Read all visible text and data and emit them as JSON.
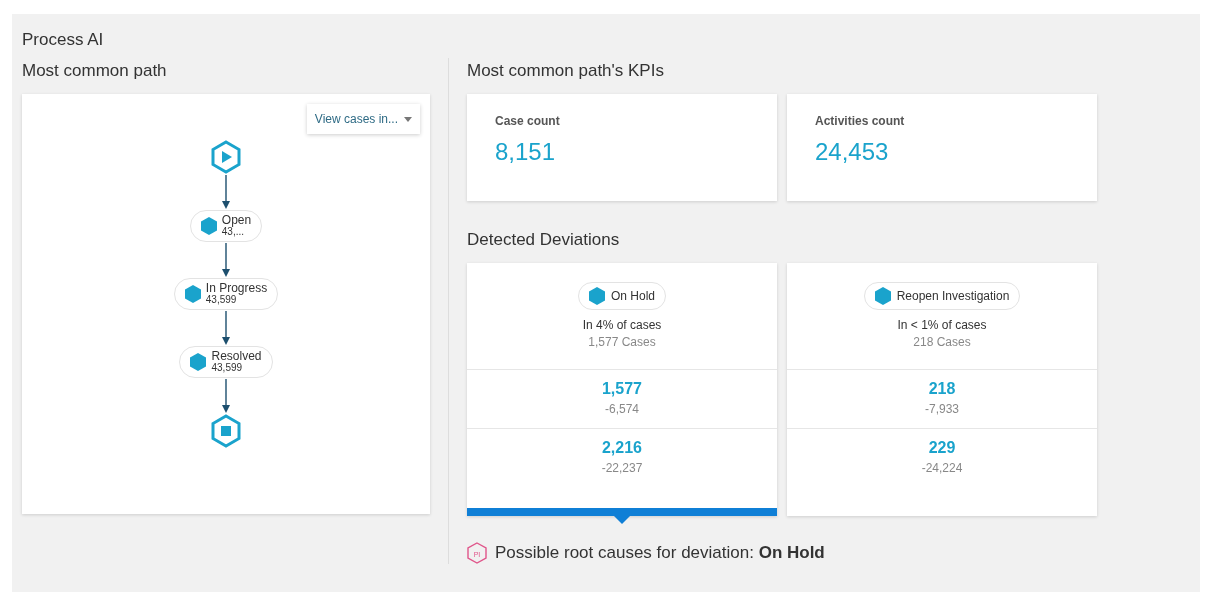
{
  "title": "Process AI",
  "left": {
    "heading": "Most common path",
    "dropdown": {
      "label": "View cases in..."
    },
    "path": [
      {
        "kind": "start"
      },
      {
        "kind": "activity",
        "name": "Open",
        "count": "43,..."
      },
      {
        "kind": "activity",
        "name": "In Progress",
        "count": "43,599"
      },
      {
        "kind": "activity",
        "name": "Resolved",
        "count": "43,599"
      },
      {
        "kind": "end"
      }
    ]
  },
  "kpis": {
    "heading": "Most common path's KPIs",
    "cards": [
      {
        "label": "Case count",
        "value": "8,151"
      },
      {
        "label": "Activities count",
        "value": "24,453"
      }
    ]
  },
  "deviations": {
    "heading": "Detected Deviations",
    "cards": [
      {
        "name": "On Hold",
        "share": "In 4% of cases",
        "cases": "1,577 Cases",
        "selected": true,
        "rows": [
          {
            "value": "1,577",
            "delta": "-6,574"
          },
          {
            "value": "2,216",
            "delta": "-22,237"
          }
        ]
      },
      {
        "name": "Reopen Investigation",
        "share": "In < 1% of cases",
        "cases": "218 Cases",
        "selected": false,
        "rows": [
          {
            "value": "218",
            "delta": "-7,933"
          },
          {
            "value": "229",
            "delta": "-24,224"
          }
        ]
      }
    ]
  },
  "root_causes": {
    "icon_text": "PI",
    "text": "Possible root causes for deviation: **On Hold**"
  }
}
